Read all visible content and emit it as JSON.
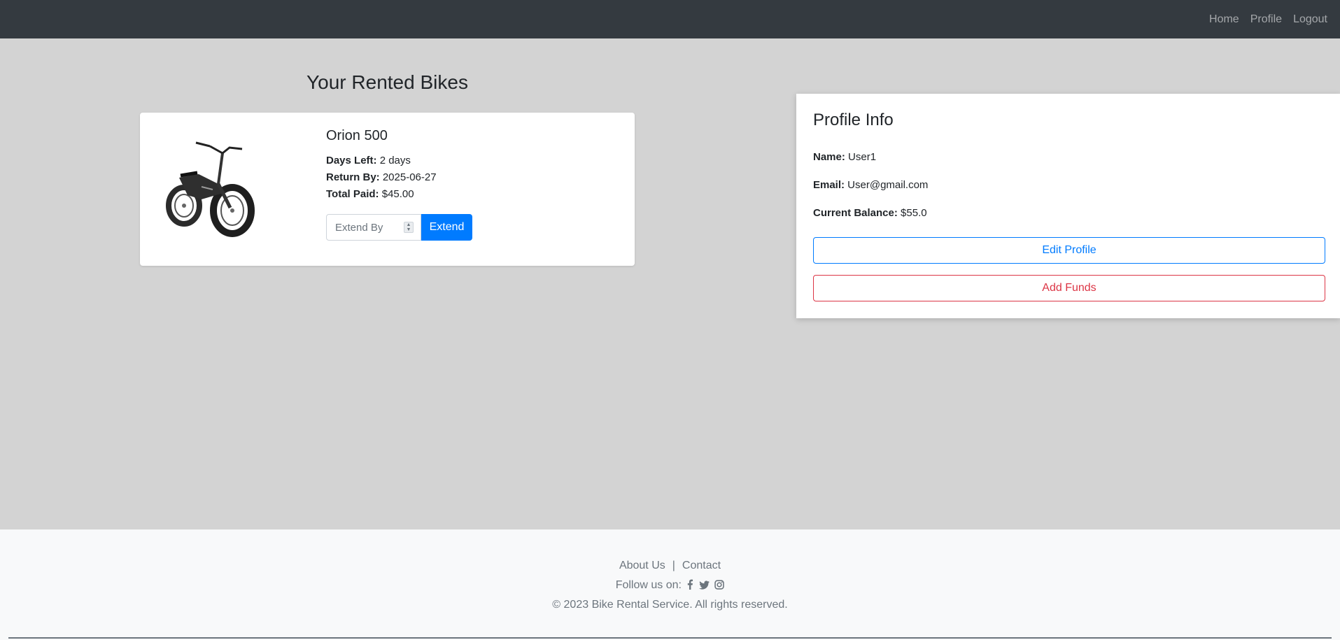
{
  "nav": {
    "links": [
      {
        "label": "Home"
      },
      {
        "label": "Profile"
      },
      {
        "label": "Logout"
      }
    ]
  },
  "rented": {
    "title": "Your Rented Bikes",
    "bike": {
      "name": "Orion 500",
      "days_left_label": "Days Left:",
      "days_left_value": " 2 days",
      "return_by_label": "Return By:",
      "return_by_value": " 2025-06-27",
      "total_paid_label": "Total Paid:",
      "total_paid_value": " $45.00",
      "extend_placeholder": "Extend By",
      "extend_button": "Extend"
    }
  },
  "profile": {
    "title": "Profile Info",
    "name_label": "Name:",
    "name_value": " User1",
    "email_label": "Email:",
    "email_value": " User@gmail.com",
    "balance_label": "Current Balance:",
    "balance_value": " $55.0",
    "edit_button": "Edit Profile",
    "funds_button": "Add Funds"
  },
  "footer": {
    "about": "About Us",
    "separator": "|",
    "contact": "Contact",
    "follow": "Follow us on:",
    "social_icons": [
      "facebook-icon",
      "twitter-icon",
      "instagram-icon"
    ],
    "copyright": "© 2023 Bike Rental Service. All rights reserved."
  },
  "colors": {
    "navbar": "#343a40",
    "page_background": "#d3d3d3",
    "primary": "#007bff",
    "danger": "#dc3545",
    "footer_background": "#f8f9fa"
  }
}
